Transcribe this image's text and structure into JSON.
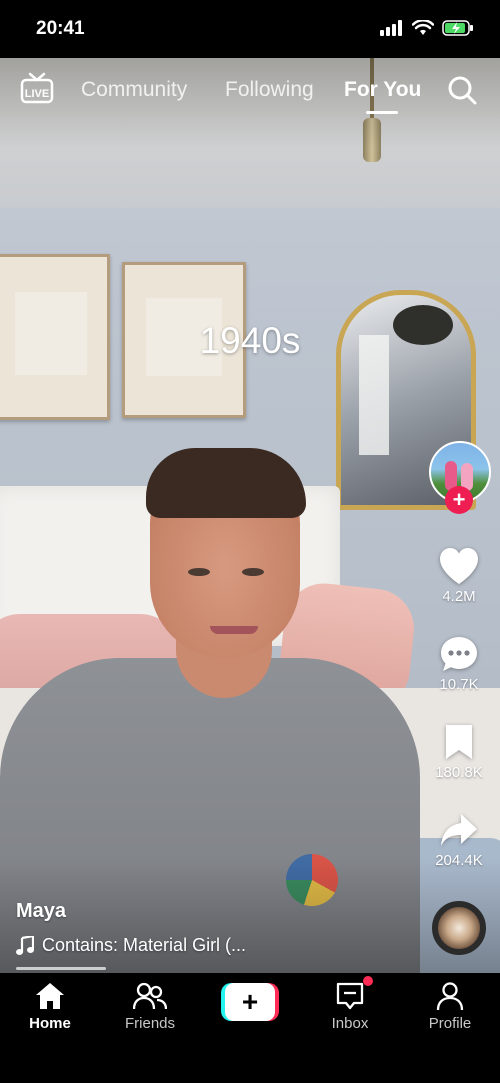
{
  "status": {
    "time": "20:41"
  },
  "topnav": {
    "live_label": "LIVE",
    "tabs": [
      {
        "label": "Community"
      },
      {
        "label": "Following"
      },
      {
        "label": "For You",
        "active": true
      }
    ]
  },
  "video": {
    "overlay_text": "1940s"
  },
  "rail": {
    "likes": "4.2M",
    "comments": "10.7K",
    "saves": "180.8K",
    "shares": "204.4K"
  },
  "caption": {
    "author": "Maya",
    "sound": "Contains: Material Girl (..."
  },
  "playback": {
    "progress": 0.18
  },
  "bottombar": {
    "items": [
      {
        "label": "Home",
        "active": true
      },
      {
        "label": "Friends"
      },
      {
        "label": "Inbox",
        "has_notification": true
      },
      {
        "label": "Profile"
      }
    ]
  },
  "colors": {
    "accent_red": "#fe2c55",
    "accent_cyan": "#25f4ee",
    "follow_red": "#ee1d52"
  }
}
